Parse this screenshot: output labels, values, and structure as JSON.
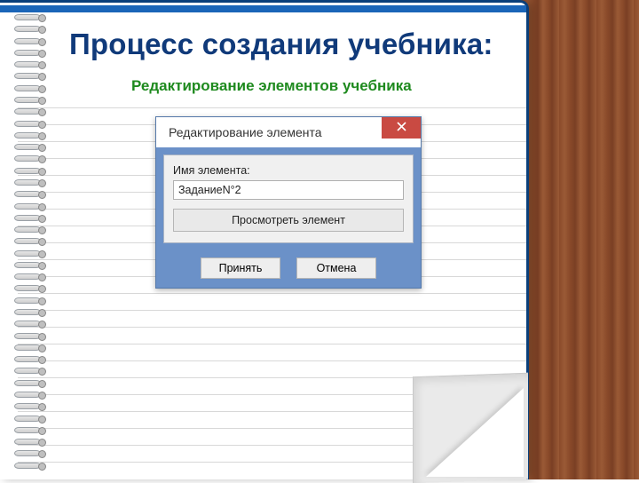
{
  "slide": {
    "title": "Процесс создания учебника:",
    "subtitle": "Редактирование элементов учебника"
  },
  "dialog": {
    "title": "Редактирование элемента",
    "field_label": "Имя элемента:",
    "field_value": "ЗаданиеN°2",
    "view_button": "Просмотреть элемент",
    "accept_button": "Принять",
    "cancel_button": "Отмена"
  },
  "colors": {
    "title_color": "#103a7a",
    "subtitle_color": "#1e8a1e",
    "dialog_frame": "#6b91c8",
    "close_button": "#c94a42"
  }
}
